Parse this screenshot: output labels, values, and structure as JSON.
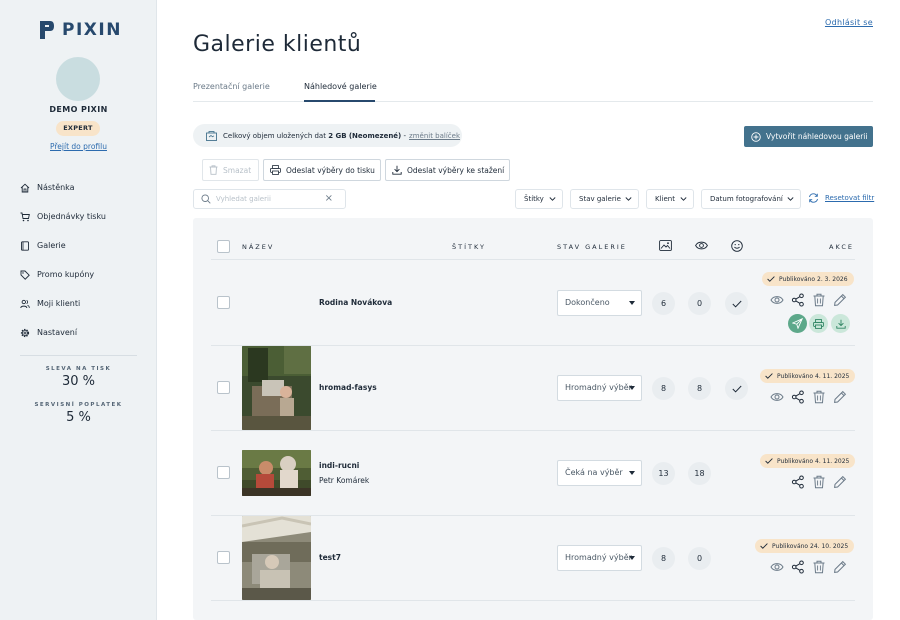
{
  "brand": {
    "name": "PIXIN"
  },
  "sidebar": {
    "user_name": "DEMO PIXIN",
    "plan_badge": "EXPERT",
    "profile_link": "Přejít do profilu",
    "items": [
      {
        "label": "Nástěnka",
        "icon": "home-icon"
      },
      {
        "label": "Objednávky tisku",
        "icon": "cart-icon"
      },
      {
        "label": "Galerie",
        "icon": "book-icon"
      },
      {
        "label": "Promo kupóny",
        "icon": "tag-icon"
      },
      {
        "label": "Moji klienti",
        "icon": "users-icon"
      },
      {
        "label": "Nastavení",
        "icon": "gear-icon"
      }
    ],
    "print_discount_label": "SLEVA NA TISK",
    "print_discount_value": "30 %",
    "service_fee_label": "SERVISNÍ POPLATEK",
    "service_fee_value": "5 %"
  },
  "header": {
    "logout": "Odhlásit se",
    "title": "Galerie klientů"
  },
  "tabs": [
    {
      "label": "Prezentační galerie",
      "active": false
    },
    {
      "label": "Náhledové galerie",
      "active": true
    }
  ],
  "storage": {
    "prefix": "Celkový objem uložených dat",
    "amount": "2 GB",
    "plan": "(Neomezené)",
    "separator": "-",
    "change_link": "změnit balíček"
  },
  "create_button": "Vytvořit náhledovou galerii",
  "actions": {
    "delete": "Smazat",
    "send_print": "Odeslat výběry do tisku",
    "send_download": "Odeslat výběry ke stažení"
  },
  "filters": {
    "search_placeholder": "Vyhledat galerii",
    "tags": "Štítky",
    "gallery_status": "Stav galerie",
    "client": "Klient",
    "photo_date": "Datum fotografování",
    "reset": "Resetovat filtr"
  },
  "table": {
    "headers": {
      "name": "NÁZEV",
      "tags": "ŠTÍTKY",
      "status": "STAV GALERIE",
      "actions": "AKCE"
    },
    "rows": [
      {
        "name": "Rodina Novákova",
        "client": "",
        "status": "Dokončeno",
        "photos": "6",
        "views": "0",
        "published": "Publikováno 2. 3. 2026",
        "has_thumb": false,
        "done": true
      },
      {
        "name": "hromad-fasys",
        "client": "",
        "status": "Hromadný výběr",
        "photos": "8",
        "views": "8",
        "published": "Publikováno 4. 11. 2025",
        "has_thumb": true,
        "done": true
      },
      {
        "name": "indi-rucni",
        "client": "Petr Komárek",
        "status": "Čeká na výběr",
        "photos": "13",
        "views": "18",
        "published": "Publikováno 4. 11. 2025",
        "has_thumb": true,
        "done": false
      },
      {
        "name": "test7",
        "client": "",
        "status": "Hromadný výběr",
        "photos": "8",
        "views": "0",
        "published": "Publikováno 24. 10. 2025",
        "has_thumb": true,
        "done": false
      }
    ]
  },
  "colors": {
    "brand": "#27496d",
    "accent_button": "#43728d",
    "link": "#2c6bae",
    "badge_bg": "#f8e4c9",
    "panel_bg": "#f3f5f7",
    "sidebar_bg": "#eef2f4",
    "green_action": "#5da88a"
  }
}
